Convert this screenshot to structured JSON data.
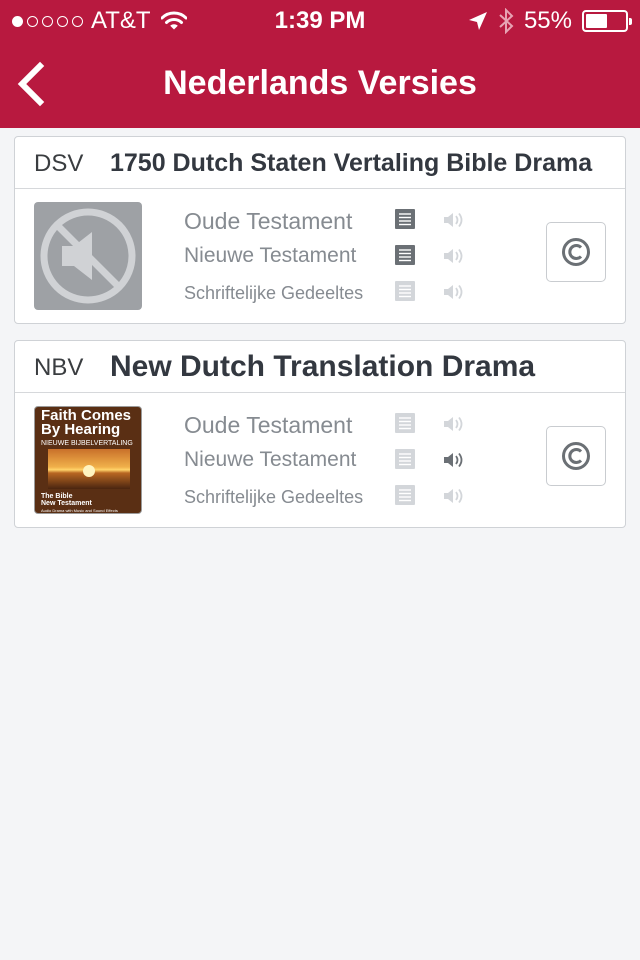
{
  "status_bar": {
    "signal_dots": [
      true,
      false,
      false,
      false,
      false
    ],
    "carrier": "AT&T",
    "time": "1:39 PM",
    "battery_percent": "55%",
    "battery_level": 0.55
  },
  "nav": {
    "title": "Nederlands Versies",
    "back_icon": "chevron-left-icon"
  },
  "colors": {
    "brand": "#b8193f",
    "background": "#f4f5f7",
    "text_dark": "#333840",
    "text_muted": "#868b91",
    "icon_active": "#6b7075",
    "icon_inactive": "#d3d6da"
  },
  "versions": [
    {
      "abbr": "DSV",
      "title": "1750 Dutch Staten Vertaling Bible Drama",
      "thumbnail": "no-audio-placeholder",
      "rows": [
        {
          "label": "Oude Testament",
          "text_available": true,
          "audio_available": false
        },
        {
          "label": "Nieuwe Testament",
          "text_available": true,
          "audio_available": false
        },
        {
          "label": "Schriftelijke Gedeeltes",
          "text_available": false,
          "audio_available": false
        }
      ],
      "copyright_icon": "copyright-icon"
    },
    {
      "abbr": "NBV",
      "title": "New Dutch Translation Drama",
      "thumbnail": "album-cover",
      "cover": {
        "line1": "Faith Comes",
        "line2": "By Hearing",
        "subtitle": "NIEUWE BIJBELVERTALING",
        "footer1": "The Bible",
        "footer2": "New Testament",
        "footer3": "Audio Drama with Music and Sound Effects"
      },
      "rows": [
        {
          "label": "Oude Testament",
          "text_available": false,
          "audio_available": false
        },
        {
          "label": "Nieuwe Testament",
          "text_available": false,
          "audio_available": true
        },
        {
          "label": "Schriftelijke Gedeeltes",
          "text_available": false,
          "audio_available": false
        }
      ],
      "copyright_icon": "copyright-icon"
    }
  ]
}
